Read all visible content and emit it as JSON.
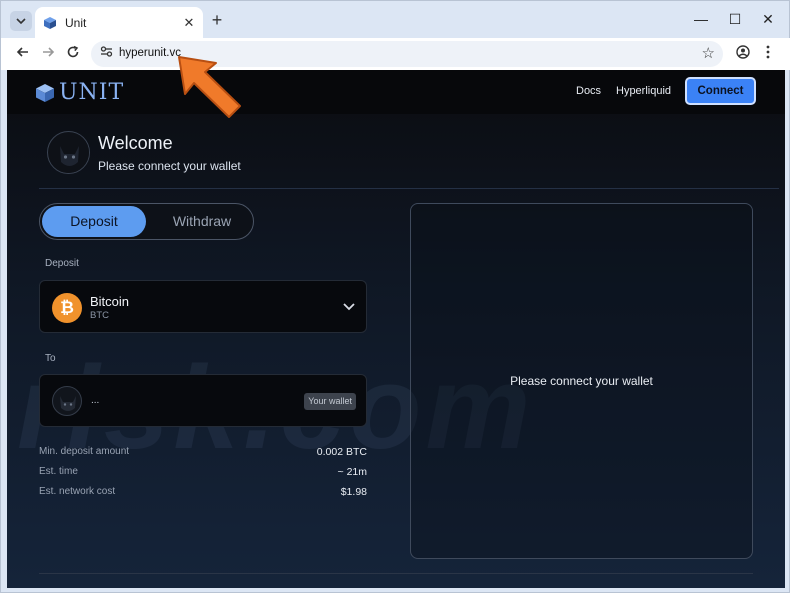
{
  "browser": {
    "tab_title": "Unit",
    "url": "hyperunit.vc",
    "tab_close": "✕",
    "new_tab": "+",
    "window": {
      "minimize": "—",
      "maximize": "☐",
      "close": "✕"
    }
  },
  "nav": {
    "logo_text": "UNIT",
    "links": [
      "Docs",
      "Hyperliquid"
    ],
    "connect_label": "Connect"
  },
  "welcome": {
    "title": "Welcome",
    "subtitle": "Please connect your wallet"
  },
  "toggle": {
    "deposit_label": "Deposit",
    "withdraw_label": "Withdraw",
    "selected": "Deposit"
  },
  "deposit": {
    "section_label": "Deposit",
    "asset_name": "Bitcoin",
    "asset_ticker": "BTC",
    "asset_icon": "₿"
  },
  "to": {
    "section_label": "To",
    "wallet_placeholder": "...",
    "wallet_badge": "Your wallet"
  },
  "stats": [
    {
      "label": "Min. deposit amount",
      "value": "0.002 BTC"
    },
    {
      "label": "Est. time",
      "value": "~ 21m"
    },
    {
      "label": "Est. network cost",
      "value": "$1.98"
    }
  ],
  "right_panel": {
    "message": "Please connect your wallet"
  },
  "watermark": "risk.com",
  "colors": {
    "accent": "#3b82f6",
    "toggle_active": "#5d9cf0",
    "bitcoin": "#f0922c",
    "arrow": "#f07a2a"
  }
}
